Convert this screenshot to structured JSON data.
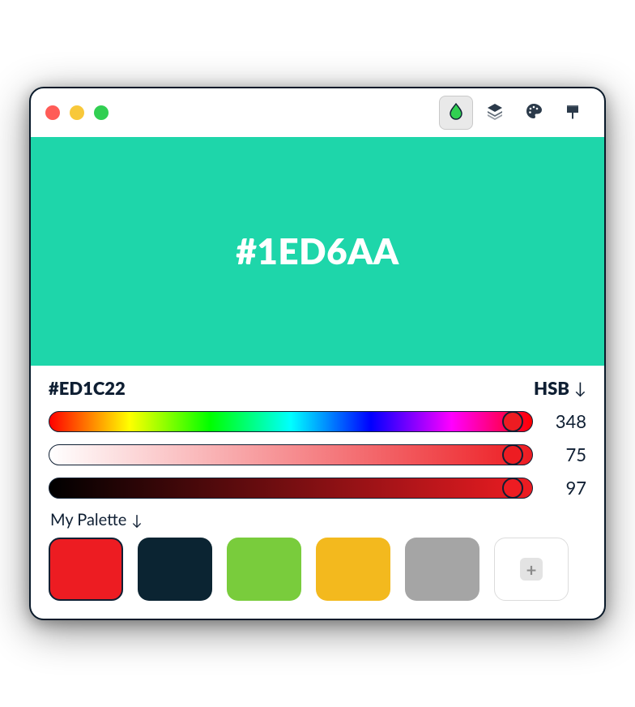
{
  "hero": {
    "color": "#1ED6AA",
    "label": "#1ED6AA"
  },
  "picker": {
    "hex": "#ED1C22",
    "mode": "HSB",
    "hue": {
      "value": 348,
      "thumb_pct": 96.0,
      "thumb_color": "#ED1C22"
    },
    "sat": {
      "value": 75,
      "thumb_pct": 96.0,
      "thumb_color": "#ED1C22"
    },
    "bri": {
      "value": 97,
      "thumb_pct": 96.0,
      "thumb_color": "#ED1C22"
    }
  },
  "palette": {
    "label": "My Palette",
    "swatches": [
      {
        "color": "#ED1C22",
        "selected": true
      },
      {
        "color": "#0B2432",
        "selected": false
      },
      {
        "color": "#79CC3C",
        "selected": false
      },
      {
        "color": "#F3B91E",
        "selected": false
      },
      {
        "color": "#A5A5A5",
        "selected": false
      }
    ],
    "add_label": "+"
  },
  "toolbar": {
    "active_index": 0
  }
}
